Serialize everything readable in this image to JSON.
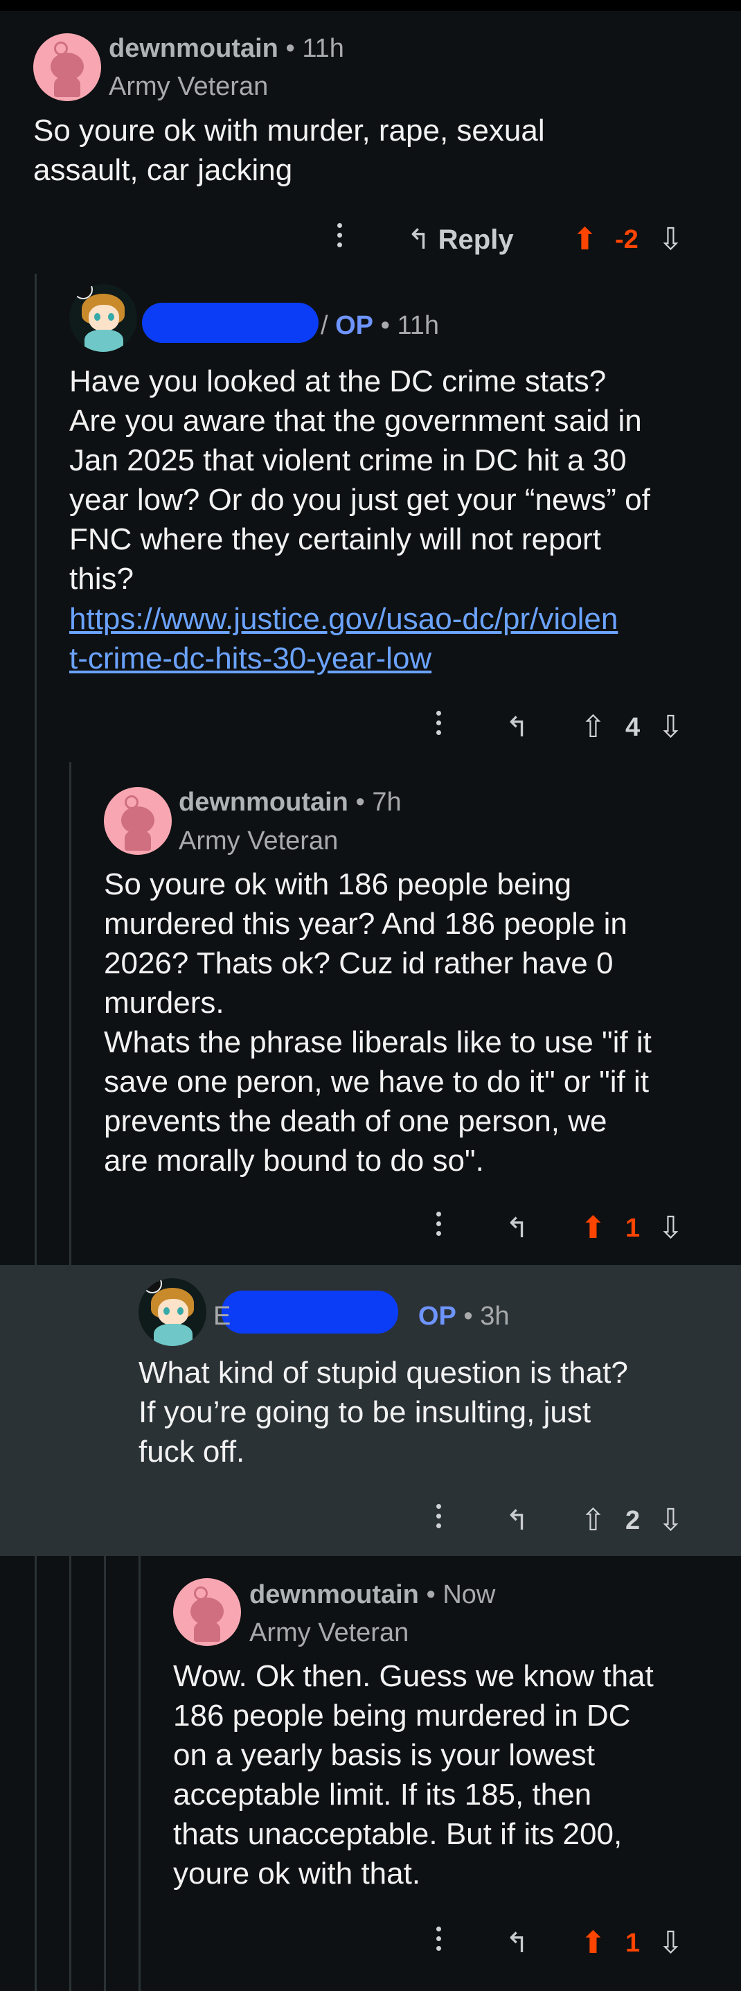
{
  "comments": [
    {
      "username": "dewnmoutain",
      "time": "11h",
      "flair": "Army Veteran",
      "body": "So youre ok with murder, rape, sexual\nassault, car jacking",
      "reply_label": "Reply",
      "score": "-2",
      "upvoted": true
    },
    {
      "username_visible": "/",
      "op_tag": "OP",
      "time": "11h",
      "body": "Have you looked at the DC crime stats?\nAre you aware that the government said in\nJan 2025 that violent crime in DC hit a 30\nyear low? Or do you just get your “news” of\nFNC where they certainly will not report\nthis?",
      "link": "https://www.justice.gov/usao-dc/pr/violen\nt-crime-dc-hits-30-year-low",
      "score": "4",
      "upvoted": false
    },
    {
      "username": "dewnmoutain",
      "time": "7h",
      "flair": "Army Veteran",
      "body": "So youre ok with 186 people being\nmurdered this year? And 186 people in\n2026? Thats ok? Cuz id rather have 0\nmurders.\nWhats the phrase liberals like to use \"if it\nsave one peron, we have to do it\" or \"if it\nprevents the death of one person, we\nare morally bound to do so\".",
      "score": "1",
      "upvoted": true
    },
    {
      "username_visible": "E",
      "op_tag": "OP",
      "time": "3h",
      "body": "What kind of stupid question is that?\nIf you’re going to be insulting, just\nfuck off.",
      "score": "2",
      "upvoted": false
    },
    {
      "username": "dewnmoutain",
      "time": "Now",
      "flair": "Army Veteran",
      "body": "Wow. Ok then. Guess we know that\n186 people being murdered in DC\non a yearly basis is your lowest\nacceptable limit. If its 185, then\nthats unacceptable. But if its 200,\nyoure ok with that.",
      "score": "1",
      "upvoted": true
    }
  ],
  "icons": {
    "more": "more-options-icon",
    "reply": "reply-arrow-icon",
    "upvote": "upvote-arrow-icon",
    "downvote": "downvote-arrow-icon"
  },
  "colors": {
    "background": "#0e1113",
    "highlight": "#2b3236",
    "upvote": "#ff4500",
    "op": "#6e95ff",
    "link": "#6ba3ff",
    "redaction": "#0a3df5"
  }
}
